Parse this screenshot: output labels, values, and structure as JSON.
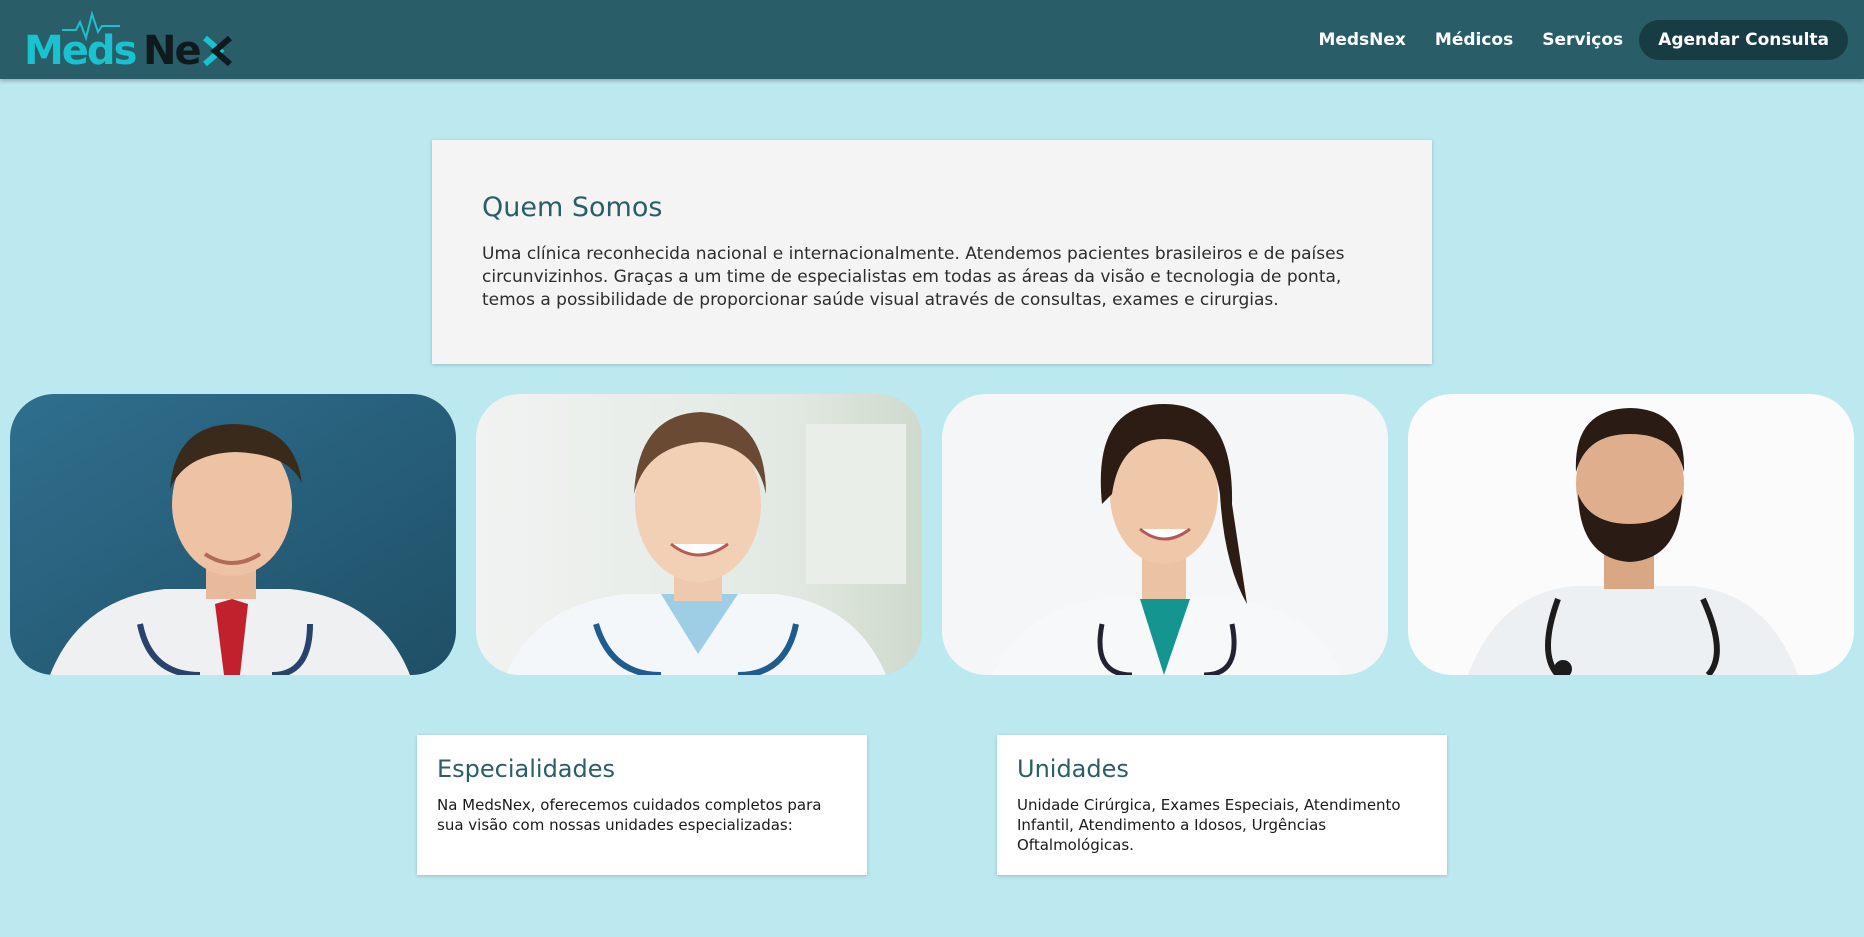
{
  "header": {
    "brand": "MedsNex",
    "nav": [
      {
        "label": "MedsNex"
      },
      {
        "label": "Médicos"
      },
      {
        "label": "Serviços"
      }
    ],
    "cta_label": "Agendar Consulta"
  },
  "about": {
    "title": "Quem Somos",
    "text": "Uma clínica reconhecida nacional e internacionalmente. Atendemos pacientes brasileiros e de países circunvizinhos. Graças a um time de especialistas em todas as áreas da visão e tecnologia de ponta, temos a possibilidade de proporcionar saúde visual através de consultas, exames e cirurgias."
  },
  "doctors": [
    {
      "name": "doctor-photo-1"
    },
    {
      "name": "doctor-photo-2"
    },
    {
      "name": "doctor-photo-3"
    },
    {
      "name": "doctor-photo-4"
    }
  ],
  "specialties": {
    "title": "Especialidades",
    "text": "Na MedsNex, oferecemos cuidados completos para sua visão com nossas unidades especializadas:"
  },
  "units": {
    "title": "Unidades",
    "text": "Unidade Cirúrgica, Exames Especiais, Atendimento Infantil, Atendimento a Idosos, Urgências Oftalmológicas."
  },
  "colors": {
    "header_bg": "#295e68",
    "page_bg": "#bce9f0",
    "cta_bg": "#173c43",
    "logo_teal": "#18c2cf",
    "logo_dark": "#0e1a1d",
    "heading": "#2a5e68"
  }
}
